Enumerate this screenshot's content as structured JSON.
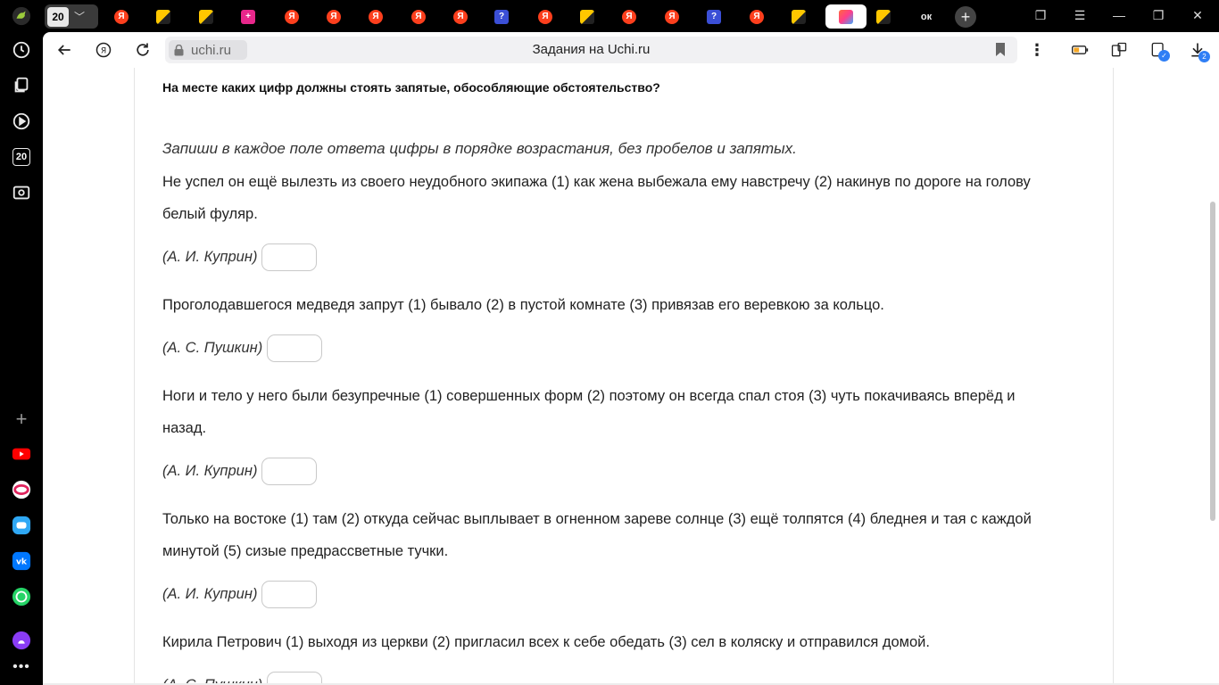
{
  "browser": {
    "tab_count": "20",
    "tabs": [
      {
        "icon": "yandex-icon",
        "glyph": "Я"
      },
      {
        "icon": "picture-icon",
        "glyph": ""
      },
      {
        "icon": "picture-icon",
        "glyph": ""
      },
      {
        "icon": "pink-app-icon",
        "glyph": "+"
      },
      {
        "icon": "yandex-icon",
        "glyph": "Я"
      },
      {
        "icon": "yandex-icon",
        "glyph": "Я"
      },
      {
        "icon": "yandex-icon",
        "glyph": "Я"
      },
      {
        "icon": "yandex-icon",
        "glyph": "Я"
      },
      {
        "icon": "yandex-icon",
        "glyph": "Я"
      },
      {
        "icon": "question-icon",
        "glyph": "?"
      },
      {
        "icon": "yandex-icon",
        "glyph": "Я"
      },
      {
        "icon": "picture-icon",
        "glyph": ""
      },
      {
        "icon": "yandex-icon",
        "glyph": "Я"
      },
      {
        "icon": "yandex-icon",
        "glyph": "Я"
      },
      {
        "icon": "question-icon",
        "glyph": "?"
      },
      {
        "icon": "yandex-icon",
        "glyph": "Я"
      },
      {
        "icon": "picture-icon",
        "glyph": ""
      },
      {
        "icon": "uchi-icon",
        "glyph": ""
      },
      {
        "icon": "picture-icon",
        "glyph": ""
      },
      {
        "icon": "ok-icon",
        "glyph": "ок"
      }
    ],
    "domain": "uchi.ru",
    "page_title": "Задания на Uchi.ru",
    "downloads_badge": "2",
    "rail_badge": "20"
  },
  "task": {
    "question": "На месте каких цифр должны стоять запятые, обособляющие обстоятельство?",
    "instruction": "Запиши в каждое поле ответа цифры в порядке возрастания, без пробелов и запятых.",
    "items": [
      {
        "sentence": "Не успел он ещё вылезть из своего неудобного экипажа (1) как жена выбежала ему навстречу (2) накинув по дороге на голову белый фуляр.",
        "source": "(А. И. Куприн)",
        "answer": ""
      },
      {
        "sentence": "Проголодавшегося медведя запрут (1) бывало (2) в пустой комнате (3) привязав его веревкою за кольцо.",
        "source": "(А. С. Пушкин)",
        "answer": ""
      },
      {
        "sentence": "Ноги и тело у него были безупречные (1) совершенных форм (2) поэтому он всегда спал стоя (3) чуть покачиваясь вперёд и назад.",
        "source": "(А. И. Куприн)",
        "answer": ""
      },
      {
        "sentence": "Только на востоке (1) там (2) откуда сейчас выплывает в огненном зареве солнце (3) ещё толпятся (4) бледнея и тая с каждой минутой (5) сизые предрассветные тучки.",
        "source": "(А. И. Куприн)",
        "answer": ""
      },
      {
        "sentence": "Кирила Петрович (1) выходя из церкви (2) пригласил всех к себе обедать (3) сел в коляску и отправился домой.",
        "source": "(А. С. Пушкин)",
        "answer": ""
      }
    ]
  }
}
